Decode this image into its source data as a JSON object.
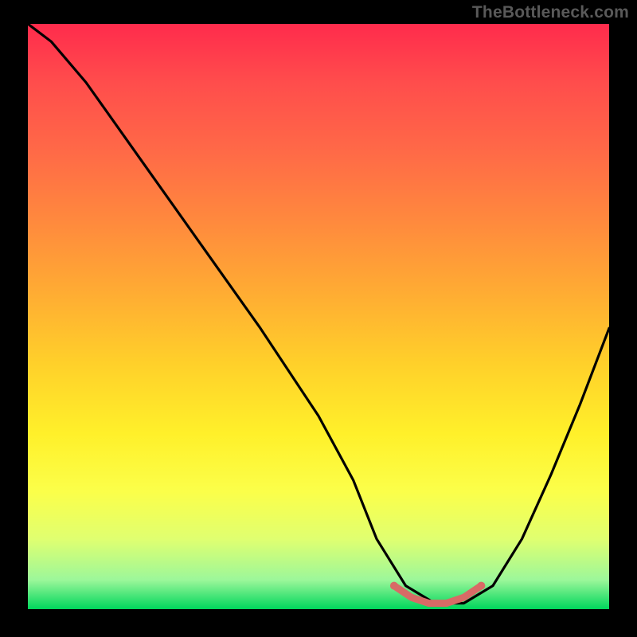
{
  "watermark": "TheBottleneck.com",
  "colors": {
    "page_bg": "#000000",
    "watermark": "#595959",
    "curve": "#000000",
    "marker": "#d86a66",
    "gradient_stops": [
      "#ff2b4c",
      "#ff4d4c",
      "#ff6a47",
      "#ff8a3d",
      "#ffac33",
      "#ffd02a",
      "#fff02a",
      "#fbff4a",
      "#e0ff70",
      "#9cf79a",
      "#00d65c"
    ]
  },
  "chart_data": {
    "type": "line",
    "title": "",
    "xlabel": "",
    "ylabel": "",
    "xlim": [
      0,
      100
    ],
    "ylim": [
      0,
      100
    ],
    "series": [
      {
        "name": "curve",
        "x": [
          0,
          4,
          10,
          20,
          30,
          40,
          50,
          56,
          60,
          65,
          70,
          75,
          80,
          85,
          90,
          95,
          100
        ],
        "y": [
          100,
          97,
          90,
          76,
          62,
          48,
          33,
          22,
          12,
          4,
          1,
          1,
          4,
          12,
          23,
          35,
          48
        ]
      }
    ],
    "markers": {
      "name": "highlight-band",
      "x": [
        63,
        66,
        69,
        72,
        75,
        78
      ],
      "y": [
        4,
        2,
        1,
        1,
        2,
        4
      ]
    }
  }
}
